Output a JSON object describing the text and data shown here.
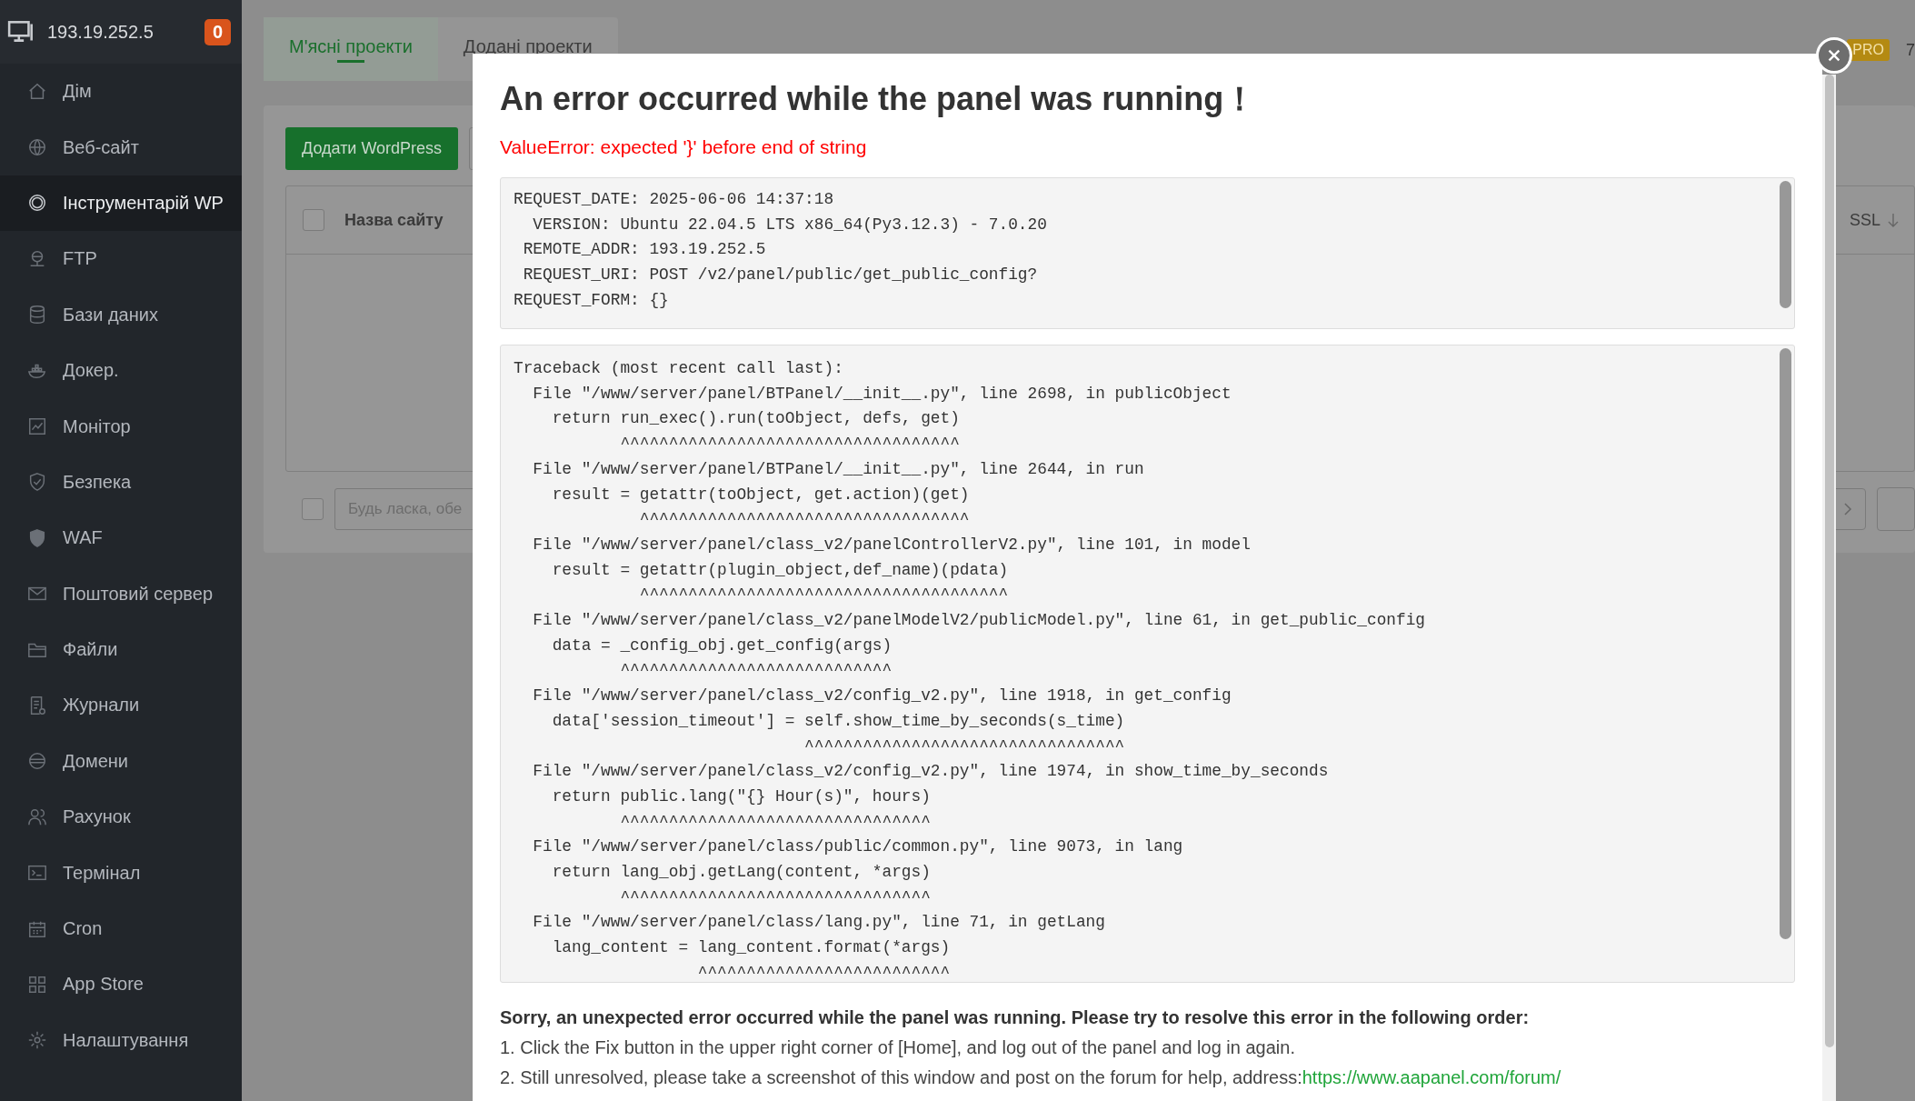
{
  "sidebar": {
    "host": "193.19.252.5",
    "badge": "0",
    "items": [
      {
        "label": "Дім",
        "selected": false
      },
      {
        "label": "Веб-сайт",
        "selected": false
      },
      {
        "label": "Інструментарій WP",
        "selected": true
      },
      {
        "label": "FTP",
        "selected": false
      },
      {
        "label": "Бази даних",
        "selected": false
      },
      {
        "label": "Докер.",
        "selected": false
      },
      {
        "label": "Монітор",
        "selected": false
      },
      {
        "label": "Безпека",
        "selected": false
      },
      {
        "label": "WAF",
        "selected": false
      },
      {
        "label": "Поштовий сервер",
        "selected": false
      },
      {
        "label": "Файли",
        "selected": false
      },
      {
        "label": "Журнали",
        "selected": false
      },
      {
        "label": "Домени",
        "selected": false
      },
      {
        "label": "Рахунок",
        "selected": false
      },
      {
        "label": "Термінал",
        "selected": false
      },
      {
        "label": "Cron",
        "selected": false
      },
      {
        "label": "App Store",
        "selected": false
      },
      {
        "label": "Налаштування",
        "selected": false
      }
    ]
  },
  "page": {
    "tabs": [
      {
        "label": "М'ясні проекти",
        "selected": true
      },
      {
        "label": "Додані проекти",
        "selected": false
      }
    ],
    "pro_badge": "PRO",
    "version_fragment": "7",
    "add_button": "Додати WordPress",
    "table": {
      "columns": [
        "Назва сайту",
        "SSL"
      ],
      "header_checkbox": {
        "checked": false
      }
    },
    "footer_checkbox": {
      "checked": false
    },
    "batch_placeholder": "Будь ласка, обе"
  },
  "dialog": {
    "title": "An error occurred while the panel was running！",
    "error": "ValueError: expected '}' before end of string",
    "request_info": [
      "REQUEST_DATE: 2025-06-06 14:37:18",
      "  VERSION: Ubuntu 22.04.5 LTS x86_64(Py3.12.3) - 7.0.20",
      " REMOTE_ADDR: 193.19.252.5",
      " REQUEST_URI: POST /v2/panel/public/get_public_config?",
      "REQUEST_FORM: {}"
    ],
    "traceback": [
      "Traceback (most recent call last):",
      "  File \"/www/server/panel/BTPanel/__init__.py\", line 2698, in publicObject",
      "    return run_exec().run(toObject, defs, get)",
      "           ^^^^^^^^^^^^^^^^^^^^^^^^^^^^^^^^^^^",
      "  File \"/www/server/panel/BTPanel/__init__.py\", line 2644, in run",
      "    result = getattr(toObject, get.action)(get)",
      "             ^^^^^^^^^^^^^^^^^^^^^^^^^^^^^^^^^^",
      "  File \"/www/server/panel/class_v2/panelControllerV2.py\", line 101, in model",
      "    result = getattr(plugin_object,def_name)(pdata)",
      "             ^^^^^^^^^^^^^^^^^^^^^^^^^^^^^^^^^^^^^^",
      "  File \"/www/server/panel/class_v2/panelModelV2/publicModel.py\", line 61, in get_public_config",
      "    data = _config_obj.get_config(args)",
      "           ^^^^^^^^^^^^^^^^^^^^^^^^^^^^",
      "  File \"/www/server/panel/class_v2/config_v2.py\", line 1918, in get_config",
      "    data['session_timeout'] = self.show_time_by_seconds(s_time)",
      "                              ^^^^^^^^^^^^^^^^^^^^^^^^^^^^^^^^^",
      "  File \"/www/server/panel/class_v2/config_v2.py\", line 1974, in show_time_by_seconds",
      "    return public.lang(\"{} Hour(s)\", hours)",
      "           ^^^^^^^^^^^^^^^^^^^^^^^^^^^^^^^^",
      "  File \"/www/server/panel/class/public/common.py\", line 9073, in lang",
      "    return lang_obj.getLang(content, *args)",
      "           ^^^^^^^^^^^^^^^^^^^^^^^^^^^^^^^^",
      "  File \"/www/server/panel/class/lang.py\", line 71, in getLang",
      "    lang_content = lang_content.format(*args)",
      "                   ^^^^^^^^^^^^^^^^^^^^^^^^^^"
    ],
    "help_heading": "Sorry, an unexpected error occurred while the panel was running. Please try to resolve this error in the following order:",
    "help_steps": [
      {
        "text": "1. Click the Fix button in the upper right corner of [Home], and log out of the panel and log in again."
      },
      {
        "text": "2. Still unresolved, please take a screenshot of this window and post on the forum for help, address:",
        "link": "https://www.aapanel.com/forum/"
      }
    ]
  }
}
